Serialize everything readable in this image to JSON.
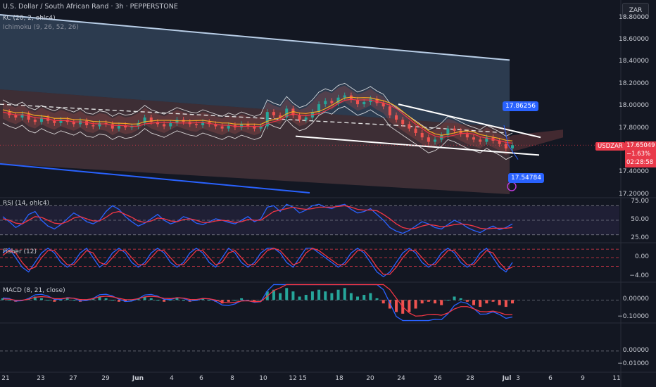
{
  "header": {
    "title": "U.S. Dollar / South African Rand · 3h · PEPPERSTONE",
    "kc": "KC (20, 2, ohlc4)",
    "ichimoku": "Ichimoku (9, 26, 52, 26)"
  },
  "toolbar": {
    "currency": "ZAR"
  },
  "symbol": "USDZAR",
  "current_price": {
    "value": "17.65049",
    "change": "−1.63%",
    "countdown": "02:28:58"
  },
  "annotations": {
    "upper_target": "17.86256",
    "lower_target": "17.54784"
  },
  "colors": {
    "bg": "#131722",
    "up": "#26a69a",
    "down": "#ef5350",
    "accent_blue": "#2962ff",
    "rsi": "#2962ff",
    "signal": "#f23645"
  },
  "chart_data": [
    {
      "type": "candlestick",
      "title": "U.S. Dollar / South African Rand · 3h · PEPPERSTONE",
      "y_ticks": [
        "18.80000",
        "18.60000",
        "18.40000",
        "18.20000",
        "18.00000",
        "17.80000",
        "17.40000",
        "17.20000"
      ],
      "ylim": [
        17.18,
        18.9
      ],
      "x_ticks": [
        "21",
        "23",
        "27",
        "29",
        "Jun",
        "4",
        "6",
        "8",
        "10",
        "12",
        "15",
        "18",
        "20",
        "24",
        "26",
        "28",
        "Jul",
        "3",
        "6",
        "9",
        "11"
      ],
      "close_path": [
        17.95,
        17.92,
        17.9,
        17.93,
        17.88,
        17.86,
        17.9,
        17.87,
        17.85,
        17.88,
        17.86,
        17.84,
        17.87,
        17.83,
        17.82,
        17.85,
        17.84,
        17.8,
        17.83,
        17.81,
        17.82,
        17.85,
        17.9,
        17.86,
        17.84,
        17.82,
        17.85,
        17.88,
        17.86,
        17.84,
        17.83,
        17.86,
        17.84,
        17.82,
        17.8,
        17.83,
        17.81,
        17.84,
        17.82,
        17.8,
        17.82,
        17.95,
        17.92,
        17.9,
        17.98,
        17.92,
        17.88,
        17.9,
        17.95,
        18.02,
        18.05,
        18.03,
        18.08,
        18.1,
        18.06,
        18.02,
        18.04,
        18.07,
        18.03,
        18.0,
        17.92,
        17.88,
        17.84,
        17.8,
        17.76,
        17.72,
        17.68,
        17.7,
        17.74,
        17.8,
        17.78,
        17.75,
        17.72,
        17.7,
        17.68,
        17.72,
        17.69,
        17.66,
        17.62,
        17.65
      ],
      "channel": {
        "upper": [
          18.83,
          18.42
        ],
        "lower": [
          17.48,
          17.2
        ]
      },
      "trend_lines": {
        "support": [
          17.73,
          17.56
        ],
        "resistance": [
          18.02,
          17.78
        ]
      }
    },
    {
      "type": "line",
      "title": "RSI (14, ohlc4)",
      "y_ticks": [
        "75.00",
        "50.00",
        "25.00"
      ],
      "ylim": [
        20,
        80
      ],
      "series": [
        {
          "values": [
            55,
            48,
            40,
            45,
            58,
            62,
            50,
            42,
            38,
            44,
            52,
            60,
            55,
            48,
            45,
            50,
            62,
            70,
            65,
            55,
            48,
            42,
            46,
            52,
            58,
            50,
            45,
            48,
            55,
            52,
            46,
            44,
            48,
            52,
            50,
            47,
            45,
            50,
            55,
            48,
            52,
            68,
            70,
            62,
            72,
            68,
            60,
            64,
            70,
            72,
            68,
            66,
            70,
            72,
            65,
            60,
            62,
            66,
            58,
            50,
            40,
            35,
            32,
            36,
            42,
            48,
            45,
            40,
            38,
            44,
            50,
            46,
            40,
            36,
            33,
            38,
            42,
            37,
            40,
            45
          ]
        },
        {
          "values": [
            52,
            50,
            46,
            45,
            50,
            55,
            54,
            50,
            46,
            45,
            48,
            53,
            55,
            52,
            49,
            49,
            54,
            60,
            62,
            58,
            54,
            49,
            47,
            49,
            53,
            52,
            49,
            48,
            51,
            52,
            50,
            47,
            47,
            49,
            50,
            49,
            47,
            48,
            51,
            50,
            50,
            56,
            62,
            64,
            66,
            68,
            66,
            65,
            66,
            68,
            68,
            68,
            69,
            70,
            68,
            65,
            64,
            64,
            63,
            58,
            52,
            45,
            40,
            38,
            39,
            42,
            44,
            43,
            41,
            42,
            44,
            45,
            44,
            42,
            39,
            38,
            39,
            39,
            39,
            40
          ]
        }
      ]
    },
    {
      "type": "line",
      "title": "Fisher (12)",
      "y_ticks": [
        "0.00",
        "−4.00"
      ],
      "ylim": [
        -5,
        3
      ],
      "series": [
        {
          "values": [
            1,
            2,
            0,
            -2,
            -3,
            -1,
            1,
            2,
            1,
            -1,
            -2,
            -1,
            1,
            2,
            0,
            -2,
            -1,
            1,
            2,
            1,
            -1,
            -2,
            -1,
            1,
            2,
            1,
            -1,
            -2,
            -1,
            1,
            2,
            1,
            -1,
            -2,
            0,
            2,
            1,
            -1,
            -2,
            -1,
            1,
            2,
            2,
            1,
            -1,
            -2,
            0,
            2,
            2,
            1,
            0,
            -1,
            -2,
            -1,
            1,
            2,
            1,
            -1,
            -3,
            -4,
            -3,
            -1,
            1,
            2,
            1,
            -1,
            -2,
            -1,
            1,
            2,
            1,
            -1,
            -2,
            -1,
            1,
            2,
            0,
            -2,
            -3,
            -1
          ]
        },
        {
          "values": [
            0.5,
            1.5,
            1,
            -1,
            -2.5,
            -2,
            0,
            1.5,
            1.5,
            0,
            -1.5,
            -1.5,
            0,
            1.5,
            1,
            -1,
            -1.5,
            0,
            1.5,
            1.5,
            0,
            -1.5,
            -1.5,
            0,
            1.5,
            1.5,
            0,
            -1.5,
            -1.5,
            0,
            1.5,
            1.5,
            0,
            -1.5,
            -1,
            1,
            1.5,
            0,
            -1.5,
            -1.5,
            0,
            1.5,
            2,
            1.5,
            0,
            -1.5,
            -1,
            1,
            2,
            1.5,
            0.5,
            -0.5,
            -1.5,
            -1.5,
            0,
            1.5,
            1.5,
            0,
            -2,
            -3.5,
            -3.5,
            -2,
            0,
            1.5,
            1.5,
            0,
            -1.5,
            -1.5,
            0,
            1.5,
            1.5,
            0,
            -1.5,
            -1.5,
            0,
            1.5,
            1,
            -1,
            -2.5,
            -2
          ]
        }
      ]
    },
    {
      "type": "bar",
      "title": "MACD (8, 21, close)",
      "y_ticks": [
        "0.00000",
        "−0.10000"
      ],
      "ylim": [
        -0.13,
        0.1
      ],
      "series": [
        {
          "values": [
            0.01,
            0.0,
            -0.01,
            0.0,
            0.01,
            0.02,
            0.01,
            0.0,
            -0.01,
            0.0,
            0.01,
            0.0,
            -0.01,
            0.0,
            0.01,
            0.02,
            0.01,
            0.0,
            -0.01,
            -0.01,
            0.0,
            0.01,
            0.02,
            0.01,
            0.0,
            -0.01,
            0.0,
            0.01,
            0.0,
            -0.01,
            0.0,
            0.01,
            0.0,
            -0.01,
            -0.02,
            -0.01,
            0.0,
            0.01,
            0.0,
            -0.01,
            0.0,
            0.05,
            0.06,
            0.04,
            0.07,
            0.05,
            0.02,
            0.03,
            0.05,
            0.06,
            0.05,
            0.04,
            0.06,
            0.07,
            0.04,
            0.02,
            0.03,
            0.04,
            0.01,
            -0.02,
            -0.05,
            -0.07,
            -0.08,
            -0.07,
            -0.05,
            -0.02,
            -0.01,
            -0.02,
            -0.03,
            0.0,
            0.02,
            0.01,
            -0.01,
            -0.03,
            -0.04,
            -0.02,
            -0.01,
            -0.03,
            -0.04,
            -0.02
          ]
        }
      ]
    },
    {
      "type": "line",
      "title": "",
      "y_ticks": [
        "0.00000",
        "−0.01000"
      ],
      "ylim": [
        -0.015,
        0.02
      ]
    }
  ]
}
